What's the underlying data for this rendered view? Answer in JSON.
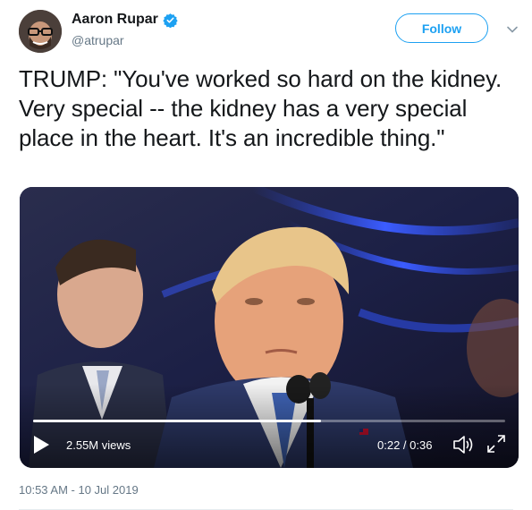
{
  "author": {
    "name": "Aaron Rupar",
    "handle": "@atrupar",
    "verified": true
  },
  "follow_button": {
    "label": "Follow"
  },
  "tweet": {
    "text": "TRUMP: \"You've worked so hard on the kidney. Very special -- the kidney has a very special place in the heart. It's an incredible thing.\"",
    "timestamp": "10:53 AM - 10 Jul 2019"
  },
  "video": {
    "views": "2.55M views",
    "time": "0:22 / 0:36",
    "progress_fraction": 0.61
  },
  "colors": {
    "accent": "#1da1f2",
    "text": "#14171a",
    "muted": "#657786"
  },
  "icons": [
    "verified-badge-icon",
    "chevron-down-icon",
    "play-icon",
    "volume-icon",
    "fullscreen-icon"
  ]
}
